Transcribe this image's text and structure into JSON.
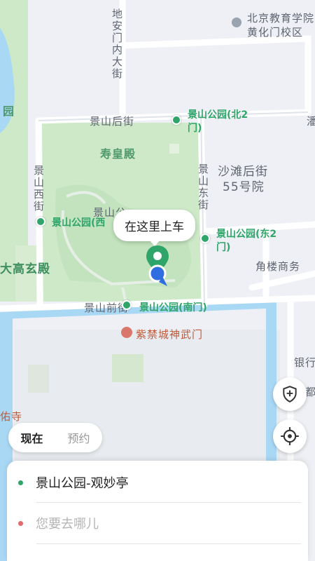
{
  "map": {
    "poi_school": "北京教育学院\n黄化门校区",
    "school_line1": "北京教育学院",
    "school_line2": "黄化门校区",
    "street_dianmen": "地安门内大街",
    "street_jingshan_hou": "景山后街",
    "street_jingshan_xi": "景山西街",
    "street_jingshan_dong": "景山东街",
    "street_jingshan_qian": "景山前街",
    "place_shouhuangdian": "寿皇殿",
    "place_shatan_line1": "沙滩后街",
    "place_shatan_line2": "55号院",
    "place_dagao": "大高玄殿",
    "place_jiaolou": "角楼商务",
    "place_yinhang": "银行",
    "place_yousi": "佑寺",
    "place_park_partial": "景山公",
    "place_left_yuan": "园",
    "place_right_edge": "潘",
    "place_du": "都",
    "gate_shenwumen": "紫禁城神武门",
    "stop_north2": "景山公园(北2门)",
    "stop_north2_line1": "景山公园(北2",
    "stop_north2_line2": "门)",
    "stop_west": "景山公园(西",
    "stop_east2": "景山公园(东2门)",
    "stop_east2_line1": "景山公园(东2",
    "stop_east2_line2": "门)",
    "stop_south": "景山公园(南门)"
  },
  "pickup_bubble": "在这里上车",
  "mode_toggle": {
    "now": "现在",
    "reserve": "预约"
  },
  "panel": {
    "origin": "景山公园-观妙亭",
    "destination_placeholder": "您要去哪儿"
  },
  "colors": {
    "accent_green": "#2fa56a",
    "pin_blue": "#2f6de1",
    "park_green": "#cde9c8",
    "moat_blue": "#a9d8f5"
  }
}
